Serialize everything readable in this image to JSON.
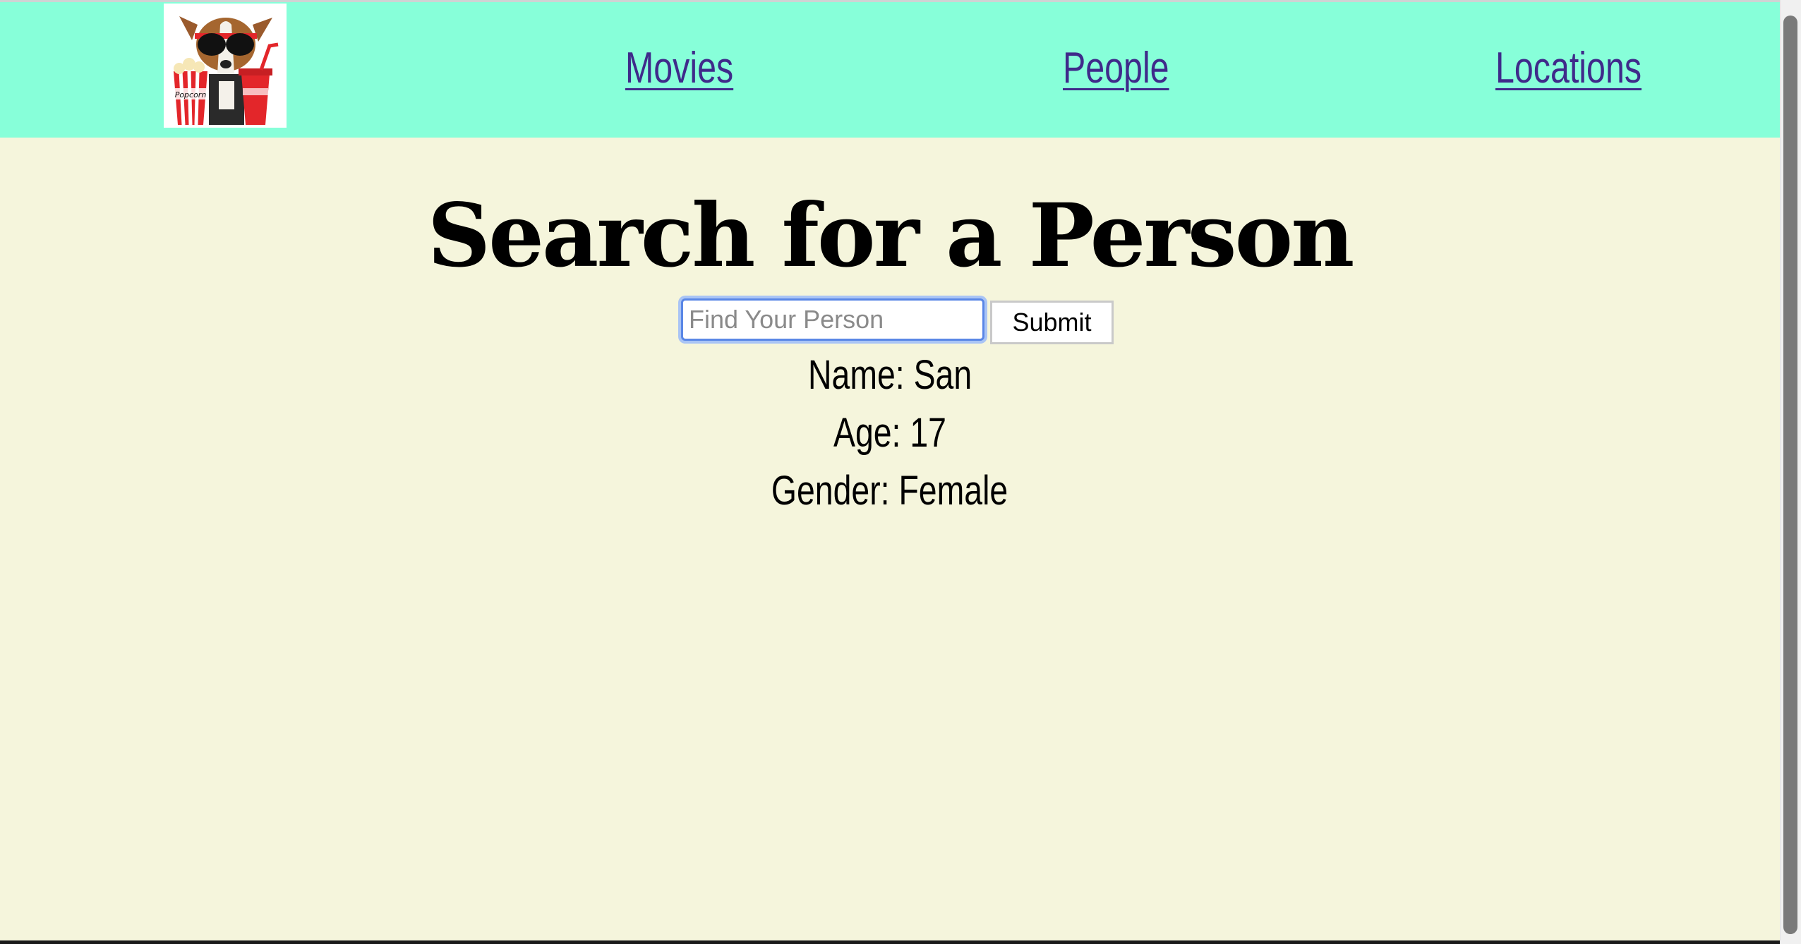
{
  "nav": {
    "links": {
      "movies": "Movies",
      "people": "People",
      "locations": "Locations"
    },
    "background": "#87ffd9",
    "link_color": "#3f2a8a"
  },
  "main": {
    "title": "Search for a Person",
    "search": {
      "placeholder": "Find Your Person",
      "value": ""
    },
    "submit_label": "Submit",
    "result": {
      "name_label": "Name: San",
      "age_label": "Age: 17",
      "gender_label": "Gender: Female"
    },
    "background": "#f5f5dc"
  },
  "icons": {
    "logo": "dog-with-popcorn-and-soda-logo"
  }
}
